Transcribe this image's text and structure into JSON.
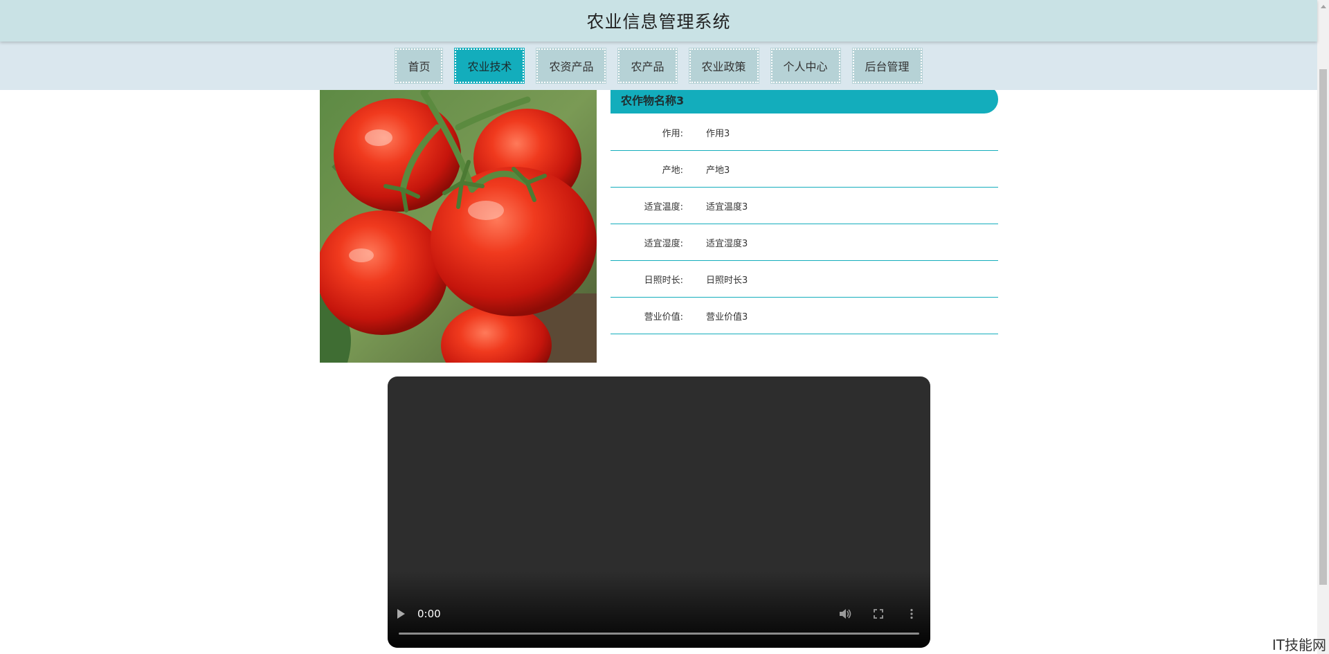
{
  "header": {
    "title": "农业信息管理系统"
  },
  "nav": {
    "items": [
      {
        "label": "首页",
        "active": false
      },
      {
        "label": "农业技术",
        "active": true
      },
      {
        "label": "农资产品",
        "active": false
      },
      {
        "label": "农产品",
        "active": false
      },
      {
        "label": "农业政策",
        "active": false
      },
      {
        "label": "个人中心",
        "active": false
      },
      {
        "label": "后台管理",
        "active": false
      }
    ]
  },
  "detail": {
    "title": "农作物名称3",
    "rows": [
      {
        "label": "作用:",
        "value": "作用3"
      },
      {
        "label": "产地:",
        "value": "产地3"
      },
      {
        "label": "适宜温度:",
        "value": "适宜温度3"
      },
      {
        "label": "适宜湿度:",
        "value": "适宜湿度3"
      },
      {
        "label": "日照时长:",
        "value": "日照时长3"
      },
      {
        "label": "营业价值:",
        "value": "营业价值3"
      }
    ]
  },
  "video": {
    "time": "0:00",
    "progress": 0
  },
  "colors": {
    "accent": "#13adbc",
    "header_bg": "#c9e2e5",
    "nav_bg": "#dae7ee",
    "nav_item_bg": "#b6d2d6"
  },
  "watermark": "IT技能网"
}
